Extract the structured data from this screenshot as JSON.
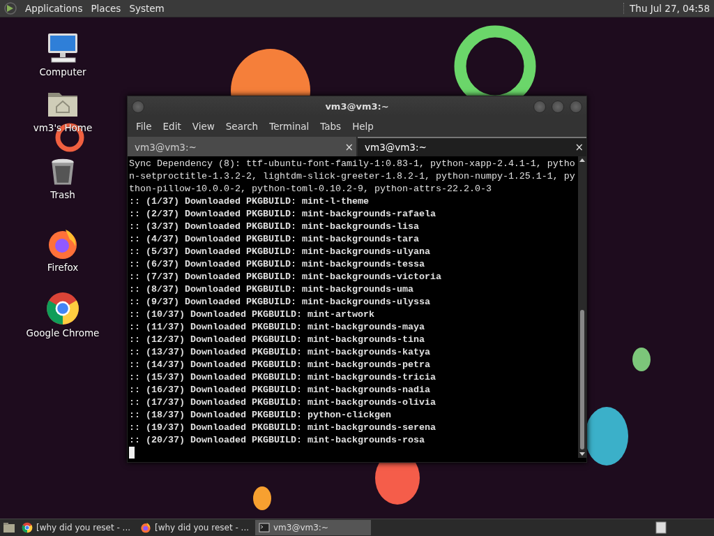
{
  "top_panel": {
    "menus": [
      "Applications",
      "Places",
      "System"
    ],
    "clock": "Thu Jul 27, 04:58"
  },
  "desktop_icons": [
    {
      "kind": "computer",
      "label": "Computer"
    },
    {
      "kind": "home",
      "label": "vm3's Home"
    },
    {
      "kind": "trash",
      "label": "Trash"
    },
    {
      "kind": "firefox",
      "label": "Firefox"
    },
    {
      "kind": "chrome",
      "label": "Google Chrome"
    }
  ],
  "terminal": {
    "title": "vm3@vm3:~",
    "menus": [
      "File",
      "Edit",
      "View",
      "Search",
      "Terminal",
      "Tabs",
      "Help"
    ],
    "tabs": [
      {
        "label": "vm3@vm3:~",
        "close": "×",
        "selected": false
      },
      {
        "label": "vm3@vm3:~",
        "close": "×",
        "selected": true
      }
    ],
    "lines": [
      {
        "kind": "plain",
        "text": "Sync Dependency (8): ttf-ubuntu-font-family-1:0.83-1, python-xapp-2.4.1-1, pytho"
      },
      {
        "kind": "plain",
        "text": "n-setproctitle-1.3.2-2, lightdm-slick-greeter-1.8.2-1, python-numpy-1.25.1-1, py"
      },
      {
        "kind": "plain",
        "text": "thon-pillow-10.0.0-2, python-toml-0.10.2-9, python-attrs-22.2.0-3"
      },
      {
        "kind": "bold",
        "text": ":: (1/37) Downloaded PKGBUILD: mint-l-theme"
      },
      {
        "kind": "bold",
        "text": ":: (2/37) Downloaded PKGBUILD: mint-backgrounds-rafaela"
      },
      {
        "kind": "bold",
        "text": ":: (3/37) Downloaded PKGBUILD: mint-backgrounds-lisa"
      },
      {
        "kind": "bold",
        "text": ":: (4/37) Downloaded PKGBUILD: mint-backgrounds-tara"
      },
      {
        "kind": "bold",
        "text": ":: (5/37) Downloaded PKGBUILD: mint-backgrounds-ulyana"
      },
      {
        "kind": "bold",
        "text": ":: (6/37) Downloaded PKGBUILD: mint-backgrounds-tessa"
      },
      {
        "kind": "bold",
        "text": ":: (7/37) Downloaded PKGBUILD: mint-backgrounds-victoria"
      },
      {
        "kind": "bold",
        "text": ":: (8/37) Downloaded PKGBUILD: mint-backgrounds-uma"
      },
      {
        "kind": "bold",
        "text": ":: (9/37) Downloaded PKGBUILD: mint-backgrounds-ulyssa"
      },
      {
        "kind": "bold",
        "text": ":: (10/37) Downloaded PKGBUILD: mint-artwork"
      },
      {
        "kind": "bold",
        "text": ":: (11/37) Downloaded PKGBUILD: mint-backgrounds-maya"
      },
      {
        "kind": "bold",
        "text": ":: (12/37) Downloaded PKGBUILD: mint-backgrounds-tina"
      },
      {
        "kind": "bold",
        "text": ":: (13/37) Downloaded PKGBUILD: mint-backgrounds-katya"
      },
      {
        "kind": "bold",
        "text": ":: (14/37) Downloaded PKGBUILD: mint-backgrounds-petra"
      },
      {
        "kind": "bold",
        "text": ":: (15/37) Downloaded PKGBUILD: mint-backgrounds-tricia"
      },
      {
        "kind": "bold",
        "text": ":: (16/37) Downloaded PKGBUILD: mint-backgrounds-nadia"
      },
      {
        "kind": "bold",
        "text": ":: (17/37) Downloaded PKGBUILD: mint-backgrounds-olivia"
      },
      {
        "kind": "bold",
        "text": ":: (18/37) Downloaded PKGBUILD: python-clickgen"
      },
      {
        "kind": "bold",
        "text": ":: (19/37) Downloaded PKGBUILD: mint-backgrounds-serena"
      },
      {
        "kind": "bold",
        "text": ":: (20/37) Downloaded PKGBUILD: mint-backgrounds-rosa"
      }
    ]
  },
  "taskbar": {
    "tasks": [
      {
        "kind": "chrome",
        "label": "[why did you reset - ...",
        "selected": false
      },
      {
        "kind": "firefox",
        "label": "[why did you reset - ...",
        "selected": false
      },
      {
        "kind": "terminal",
        "label": "vm3@vm3:~",
        "selected": true
      }
    ]
  }
}
